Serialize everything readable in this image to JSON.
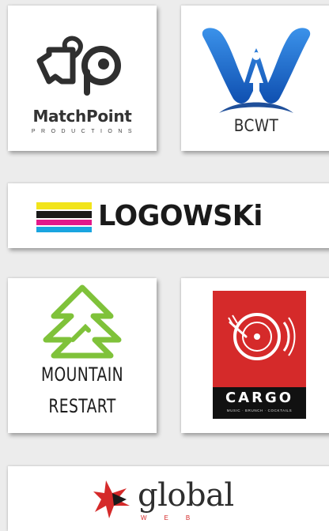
{
  "logos": {
    "matchpoint": {
      "name": "MatchPoint",
      "subtitle": "PRODUCTIONS"
    },
    "bcwt": {
      "name": "BCWT"
    },
    "logowski": {
      "name": "LOGOWSKi"
    },
    "mountain": {
      "line1": "MOUNTAIN",
      "line2": "RESTART"
    },
    "cargo": {
      "name": "CARGO",
      "subtitle": "MUSIC · BRUNCH · COCKTAILS"
    },
    "global": {
      "name": "global",
      "subtitle": "WEB"
    }
  },
  "colors": {
    "background": "#ececec",
    "card": "#ffffff",
    "bcwt_blue": "#1a6fd3",
    "mountain_green": "#7fc23a",
    "cargo_red": "#d52a2a",
    "global_red": "#d52a2a",
    "logowski_stripes": [
      "#f2e41a",
      "#e2198a",
      "#1aa5e0"
    ]
  }
}
